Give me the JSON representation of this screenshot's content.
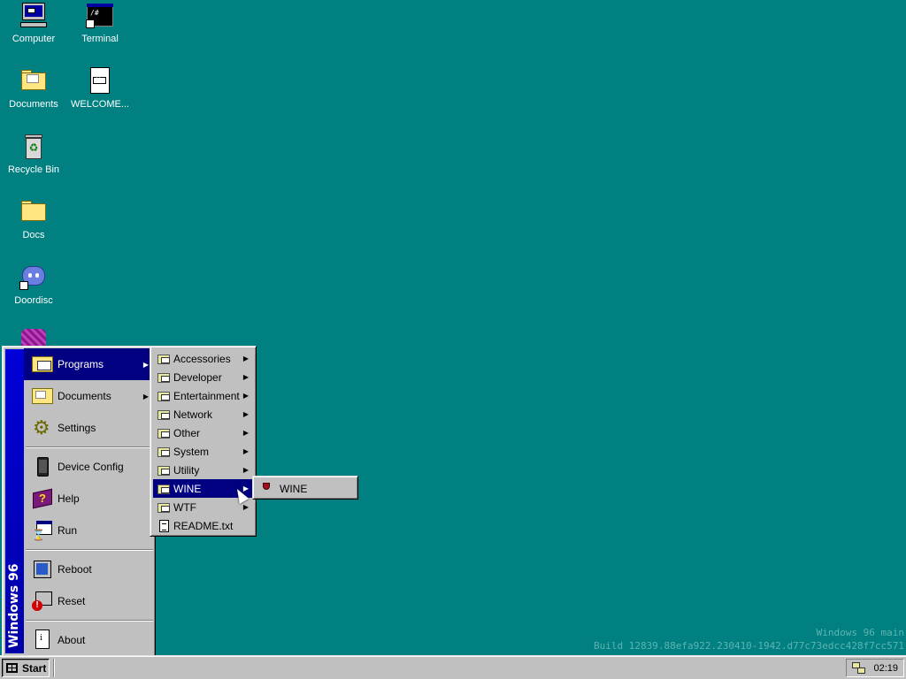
{
  "desktop": {
    "icons": [
      {
        "label": "Computer",
        "icon": "computer-icon"
      },
      {
        "label": "Terminal",
        "icon": "terminal-icon"
      },
      {
        "label": "Documents",
        "icon": "folder-open-icon"
      },
      {
        "label": "WELCOME...",
        "icon": "markdown-file-icon"
      },
      {
        "label": "Recycle Bin",
        "icon": "recycle-bin-icon"
      },
      {
        "label": "Docs",
        "icon": "folder-icon"
      },
      {
        "label": "Doordisc",
        "icon": "doordisc-icon"
      }
    ],
    "watermark": {
      "line1": "Windows 96 main",
      "line2": "Build 12839.88efa922.230410-1942.d77c73edcc428f7cc571"
    }
  },
  "start_menu": {
    "banner": "Windows 96",
    "items": [
      {
        "label": "Programs",
        "icon": "programs-folder-icon",
        "has_submenu": true,
        "active": true
      },
      {
        "label": "Documents",
        "icon": "documents-folder-icon",
        "has_submenu": true
      },
      {
        "label": "Settings",
        "icon": "settings-icon",
        "has_submenu": false
      },
      {
        "label": "Device Config",
        "icon": "device-icon",
        "has_submenu": false
      },
      {
        "label": "Help",
        "icon": "help-book-icon",
        "has_submenu": false
      },
      {
        "label": "Run",
        "icon": "run-icon",
        "has_submenu": false
      },
      {
        "label": "Reboot",
        "icon": "reboot-icon",
        "has_submenu": false
      },
      {
        "label": "Reset",
        "icon": "reset-icon",
        "has_submenu": false
      },
      {
        "label": "About",
        "icon": "about-icon",
        "has_submenu": false
      }
    ]
  },
  "programs_menu": {
    "items": [
      {
        "label": "Accessories",
        "type": "folder",
        "has_submenu": true
      },
      {
        "label": "Developer",
        "type": "folder",
        "has_submenu": true
      },
      {
        "label": "Entertainment",
        "type": "folder",
        "has_submenu": true
      },
      {
        "label": "Network",
        "type": "folder",
        "has_submenu": true
      },
      {
        "label": "Other",
        "type": "folder",
        "has_submenu": true
      },
      {
        "label": "System",
        "type": "folder",
        "has_submenu": true
      },
      {
        "label": "Utility",
        "type": "folder",
        "has_submenu": true
      },
      {
        "label": "WINE",
        "type": "folder",
        "has_submenu": true,
        "active": true
      },
      {
        "label": "WTF",
        "type": "folder",
        "has_submenu": true
      },
      {
        "label": "README.txt",
        "type": "file",
        "has_submenu": false
      }
    ]
  },
  "wine_menu": {
    "items": [
      {
        "label": "WINE",
        "icon": "wine-glass-icon"
      }
    ]
  },
  "taskbar": {
    "start_label": "Start",
    "clock": "02:19"
  },
  "colors": {
    "desktop": "#008080",
    "highlight": "#000080",
    "face": "#c0c0c0"
  }
}
